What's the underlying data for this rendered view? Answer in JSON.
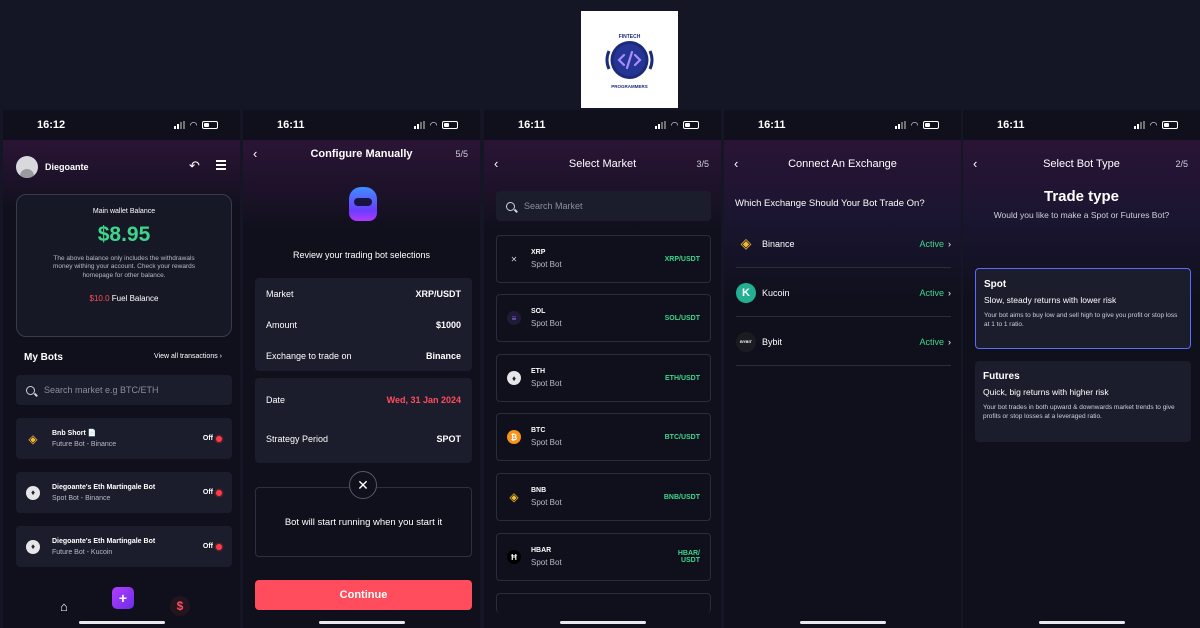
{
  "logo": {
    "top_text": "FINTECH",
    "bottom_text": "PROGRAMMERS"
  },
  "screen1": {
    "time": "16:12",
    "username": "Diegoante",
    "wallet_label": "Main wallet Balance",
    "wallet_amount": "$8.95",
    "wallet_note": "The above balance only includes the withdrawals money withing your account. Check your rewards homepage for other balance.",
    "fuel_amount": "$10.0",
    "fuel_label": "Fuel Balance",
    "my_bots": "My Bots",
    "view_all": "View all transactions",
    "search_placeholder": "Search market e.g BTC/ETH",
    "bots": [
      {
        "name": "Bnb Short 📄",
        "sub": "Future Bot - Binance",
        "status": "Off",
        "coin": "bnb"
      },
      {
        "name": "Diegoante's Eth Martingale Bot",
        "sub": "Spot Bot - Binance",
        "status": "Off",
        "coin": "eth"
      },
      {
        "name": "Diegoante's Eth Martingale Bot",
        "sub": "Future Bot - Kucoin",
        "status": "Off",
        "coin": "eth"
      }
    ],
    "nav": {
      "plus": "+",
      "dollar": "$"
    }
  },
  "screen2": {
    "time": "16:11",
    "title": "Configure Manually",
    "step": "5/5",
    "review": "Review your trading bot selections",
    "rows": [
      {
        "label": "Market",
        "value": "XRP/USDT"
      },
      {
        "label": "Amount",
        "value": "$1000"
      },
      {
        "label": "Exchange to trade on",
        "value": "Binance"
      }
    ],
    "date_label": "Date",
    "date_value": "Wed, 31 Jan 2024",
    "strategy_label": "Strategy Period",
    "strategy_value": "SPOT",
    "notice": "Bot will start running when you start it",
    "continue": "Continue"
  },
  "screen3": {
    "time": "16:11",
    "title": "Select Market",
    "step": "3/5",
    "search_placeholder": "Search Market",
    "markets": [
      {
        "sym": "XRP",
        "type": "Spot Bot",
        "pair": "XRP/USDT",
        "coin": "xrp"
      },
      {
        "sym": "SOL",
        "type": "Spot Bot",
        "pair": "SOL/USDT",
        "coin": "sol"
      },
      {
        "sym": "ETH",
        "type": "Spot Bot",
        "pair": "ETH/USDT",
        "coin": "eth"
      },
      {
        "sym": "BTC",
        "type": "Spot Bot",
        "pair": "BTC/USDT",
        "coin": "btc"
      },
      {
        "sym": "BNB",
        "type": "Spot Bot",
        "pair": "BNB/USDT",
        "coin": "bnb"
      },
      {
        "sym": "HBAR",
        "type": "Spot Bot",
        "pair": "HBAR/ USDT",
        "coin": "hbar"
      }
    ]
  },
  "screen4": {
    "time": "16:11",
    "title": "Connect An Exchange",
    "question": "Which Exchange Should Your Bot Trade On?",
    "exchanges": [
      {
        "name": "Binance",
        "status": "Active"
      },
      {
        "name": "Kucoin",
        "status": "Active"
      },
      {
        "name": "Bybit",
        "status": "Active"
      }
    ],
    "bybit_logo": "BYBIT"
  },
  "screen5": {
    "time": "16:11",
    "title": "Select Bot Type",
    "step": "2/5",
    "heading": "Trade type",
    "question": "Would you like to make a Spot or Futures Bot?",
    "options": [
      {
        "title": "Spot",
        "sub": "Slow, steady returns with lower risk",
        "desc": "Your bot aims to buy low and sell high to give you profit or stop loss at 1 to 1 ratio."
      },
      {
        "title": "Futures",
        "sub": "Quick, big returns with higher risk",
        "desc": "Your bot trades in both upward & downwards market trends to give profits or stop losses at a leveraged ratio."
      }
    ]
  },
  "colors": {
    "accent_green": "#3dd68c",
    "accent_red": "#ff4d5b",
    "continue_button": "#ff4d5e",
    "card": "#1b1d2c"
  }
}
